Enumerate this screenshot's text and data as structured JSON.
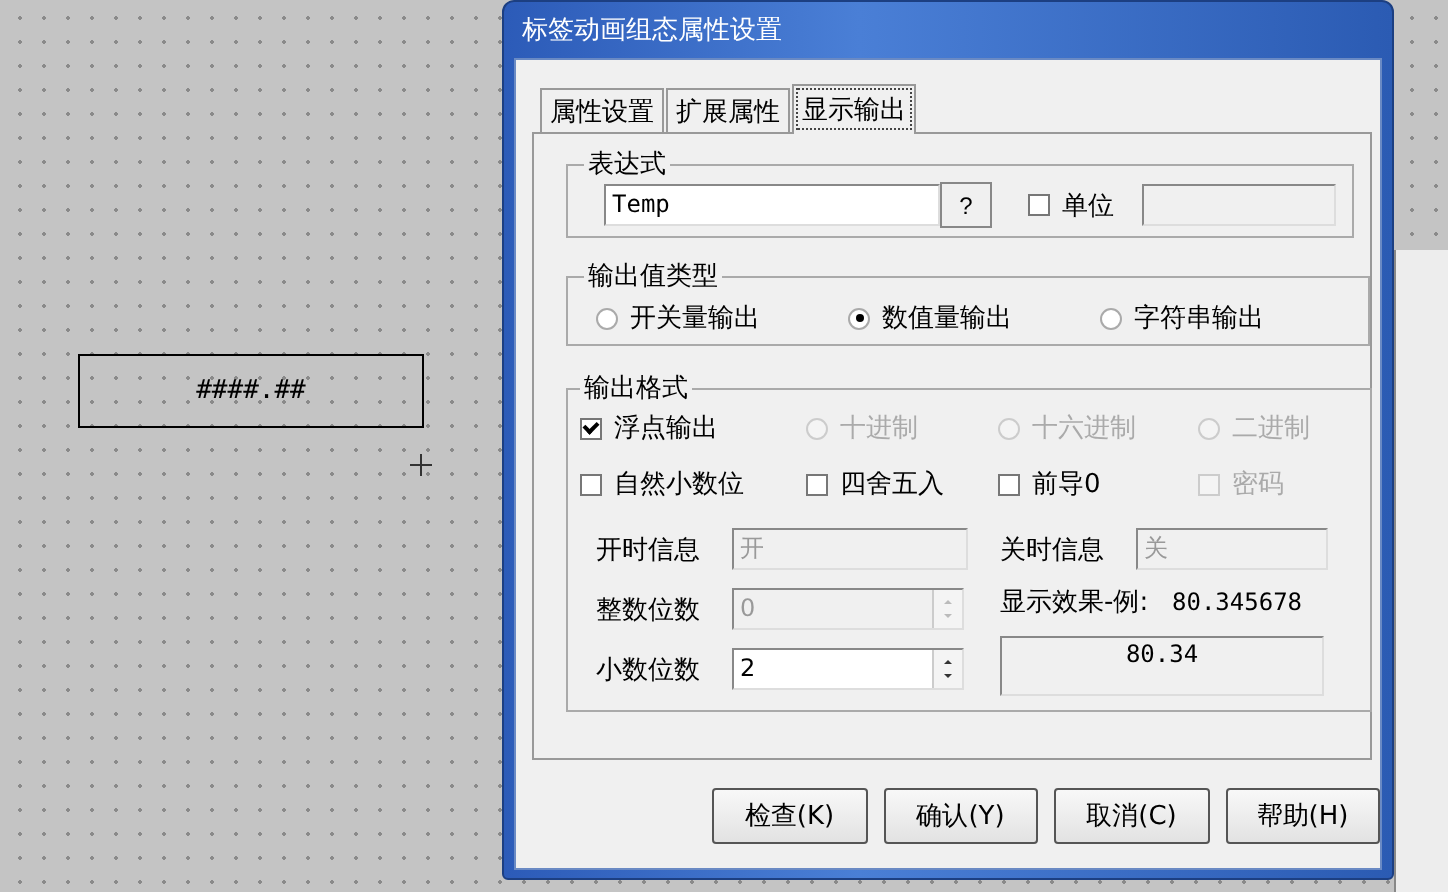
{
  "canvas": {
    "display_object": "####.##"
  },
  "window": {
    "title": "标签动画组态属性设置"
  },
  "tabs": [
    {
      "label": "属性设置",
      "selected": false
    },
    {
      "label": "扩展属性",
      "selected": false
    },
    {
      "label": "显示输出",
      "selected": true
    }
  ],
  "expression": {
    "title": "表达式",
    "value": "Temp",
    "browse_button": "?",
    "unit": {
      "label": "单位",
      "checked": false
    }
  },
  "output_type": {
    "title": "输出值类型",
    "options": [
      {
        "label": "开关量输出",
        "selected": false
      },
      {
        "label": "数值量输出",
        "selected": true
      },
      {
        "label": "字符串输出",
        "selected": false
      }
    ]
  },
  "output_format": {
    "title": "输出格式",
    "options": [
      {
        "kind": "checkbox",
        "label": "浮点输出",
        "checked": true,
        "disabled": false
      },
      {
        "kind": "radio",
        "label": "十进制",
        "selected": false,
        "disabled": true
      },
      {
        "kind": "radio",
        "label": "十六进制",
        "selected": false,
        "disabled": true
      },
      {
        "kind": "radio",
        "label": "二进制",
        "selected": false,
        "disabled": true
      },
      {
        "kind": "checkbox",
        "label": "自然小数位",
        "checked": false,
        "disabled": false
      },
      {
        "kind": "checkbox",
        "label": "四舍五入",
        "checked": false,
        "disabled": false
      },
      {
        "kind": "checkbox",
        "label": "前导0",
        "checked": false,
        "disabled": false
      },
      {
        "kind": "checkbox",
        "label": "密码",
        "checked": false,
        "disabled": true
      }
    ],
    "on_label": "开时信息",
    "on_value": "开",
    "off_label": "关时信息",
    "off_value": "关",
    "integer_digits": {
      "label": "整数位数",
      "value": "0",
      "disabled": true
    },
    "decimal_digits": {
      "label": "小数位数",
      "value": "2",
      "disabled": false
    },
    "example_label": "显示效果-例:",
    "example_value": "80.345678",
    "preview": "80.34"
  },
  "buttons": [
    "检查(K)",
    "确认(Y)",
    "取消(C)",
    "帮助(H)"
  ]
}
